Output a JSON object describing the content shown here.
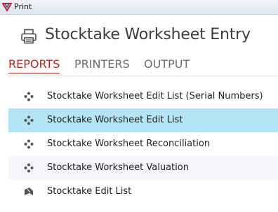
{
  "window": {
    "title": "Print"
  },
  "header": {
    "title": "Stocktake Worksheet Entry"
  },
  "tabs": [
    {
      "label": "REPORTS",
      "active": true
    },
    {
      "label": "PRINTERS",
      "active": false
    },
    {
      "label": "OUTPUT",
      "active": false
    }
  ],
  "reports": [
    {
      "label": "Stocktake Worksheet Edit List (Serial Numbers)",
      "icon": "dots-icon",
      "selected": false
    },
    {
      "label": "Stocktake Worksheet Edit List",
      "icon": "dots-icon",
      "selected": true
    },
    {
      "label": "Stocktake Worksheet Reconciliation",
      "icon": "dots-icon",
      "selected": false
    },
    {
      "label": "Stocktake Worksheet Valuation",
      "icon": "dots-icon",
      "selected": false
    },
    {
      "label": "Stocktake Edit List",
      "icon": "ribbon-icon",
      "selected": false
    }
  ],
  "colors": {
    "accent": "#b3241f",
    "selection": "#b3e5f7",
    "alt_row": "#f5f6fa"
  }
}
